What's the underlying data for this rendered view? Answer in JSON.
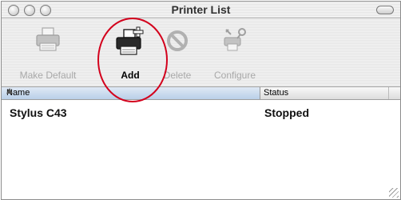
{
  "window": {
    "title": "Printer List"
  },
  "toolbar": {
    "make_default": {
      "label": "Make Default",
      "icon": "printer-icon",
      "enabled": false
    },
    "add": {
      "label": "Add",
      "icon": "printer-add-icon",
      "enabled": true
    },
    "delete": {
      "label": "Delete",
      "icon": "no-sign-icon",
      "enabled": false
    },
    "configure": {
      "label": "Configure",
      "icon": "tools-icon",
      "enabled": false
    }
  },
  "table": {
    "columns": [
      {
        "label": "Name",
        "sorted": "ascending"
      },
      {
        "label": "Status"
      }
    ],
    "rows": [
      {
        "name": "Stylus C43",
        "status": "Stopped"
      }
    ]
  },
  "annotation": {
    "highlight_color": "#d3001c",
    "highlight_target": "add"
  }
}
